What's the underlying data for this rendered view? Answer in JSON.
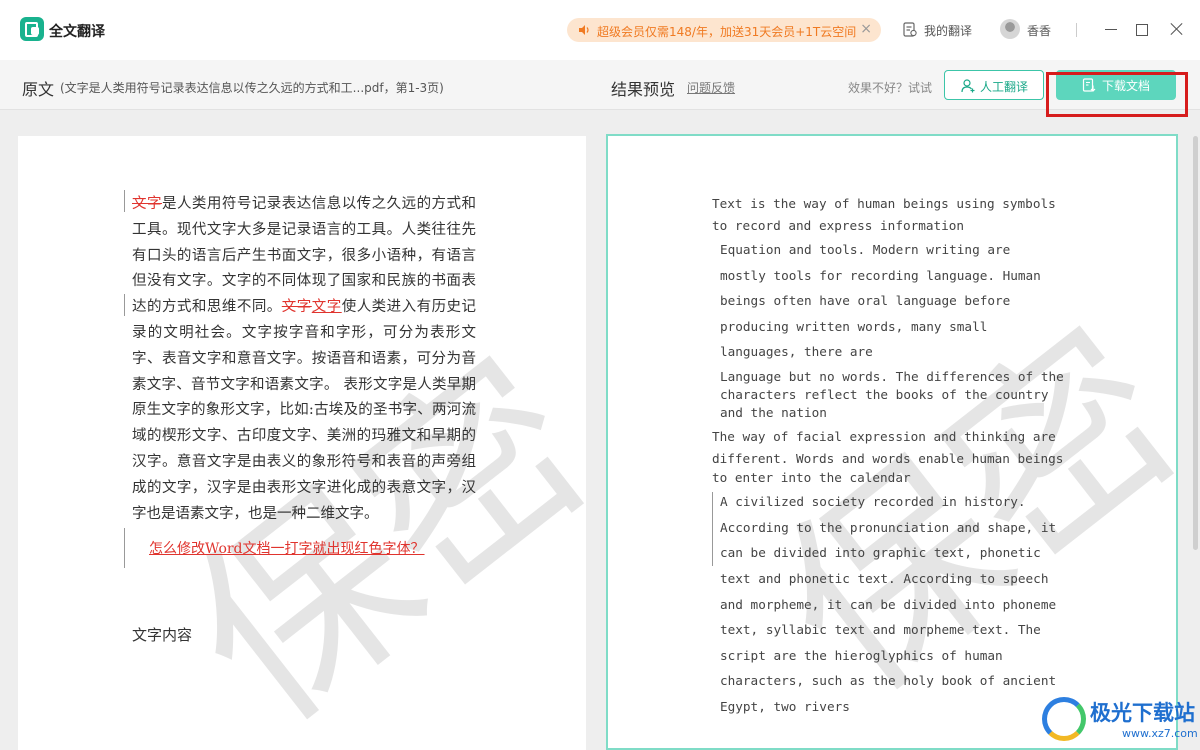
{
  "app": {
    "title": "全文翻译",
    "promo": "超级会员仅需148/年，加送31天会员+1T云空间",
    "promo_close": "×",
    "my_translations": "我的翻译",
    "user_name": "香香"
  },
  "toolbar": {
    "source_title": "原文",
    "source_info": "(文字是人类用符号记录表达信息以传之久远的方式和工...pdf，第1-3页)",
    "result_title": "结果预览",
    "feedback": "问题反馈",
    "try_text": "效果不好？试试",
    "human_translate": "人工翻译",
    "download": "下载文档"
  },
  "source": {
    "watermark": "保密",
    "struck_1": "文字",
    "text_1": "是人类用符号记录表达信息以传之久远的方式和工具。现代文字大多是记录语言的工具。人类往往先有口头的语言后产生书面文字，很多小语种，有语言但没有文字。文字的不同体现了国家和民族的书面表达的方式和思维不同。",
    "struck_2": "文字",
    "underlined_2": "文字",
    "text_2": "使人类进入有历史记录的文明社会。文字按字音和字形，可分为表形文字、表音文字和意音文字。按语音和语素，可分为音素文字、音节文字和语素文字。 表形文字是人类早期原生文字的象形文字，比如:古埃及的圣书字、两河流域的楔形文字、古印度文字、美洲的玛雅文和早期的汉字。意音文字是由表义的象形符号和表音的声旁组成的文字，汉字是由表形文字进化成的表意文字，汉字也是语素文字，也是一种二维文字。",
    "link": "怎么修改Word文档一打字就出现红色字体？",
    "heading": "文字内容"
  },
  "result": {
    "watermark": "保密",
    "lines": [
      "Text is the way of human beings using symbols",
      "to record and express information",
      "Equation and tools. Modern writing are",
      "mostly tools for recording language. Human",
      "beings often have oral language before",
      "producing written words, many small",
      "languages, there are",
      "Language but no words. The differences of the",
      "characters reflect the books of the country",
      "and the nation",
      "The way of facial expression and thinking are",
      "different. Words and words enable human beings",
      "to enter into the calendar",
      "A civilized society recorded in history.",
      "According to the pronunciation and shape, it",
      "can be divided into graphic text, phonetic",
      "text and phonetic text. According to speech",
      "and morpheme, it can be divided into phoneme",
      "text, syllabic text and morpheme text. The",
      "script are the hieroglyphics of human",
      "characters, such as the holy book of ancient",
      "Egypt, two rivers"
    ]
  },
  "corner_logo": {
    "name": "极光下载站",
    "url": "www.xz7.com"
  },
  "colors": {
    "accent": "#3cc5a8",
    "download_button": "#5dd6bd",
    "promo_background": "#fde5cf",
    "promo_text": "#f07a22",
    "highlight_red": "#d61c1c",
    "revision_red": "#e0342e"
  },
  "icons": [
    "app-logo-icon",
    "speaker-icon",
    "close-icon",
    "document-icon",
    "avatar",
    "minimize-icon",
    "maximize-icon",
    "close-window-icon",
    "person-icon",
    "download-file-icon"
  ]
}
